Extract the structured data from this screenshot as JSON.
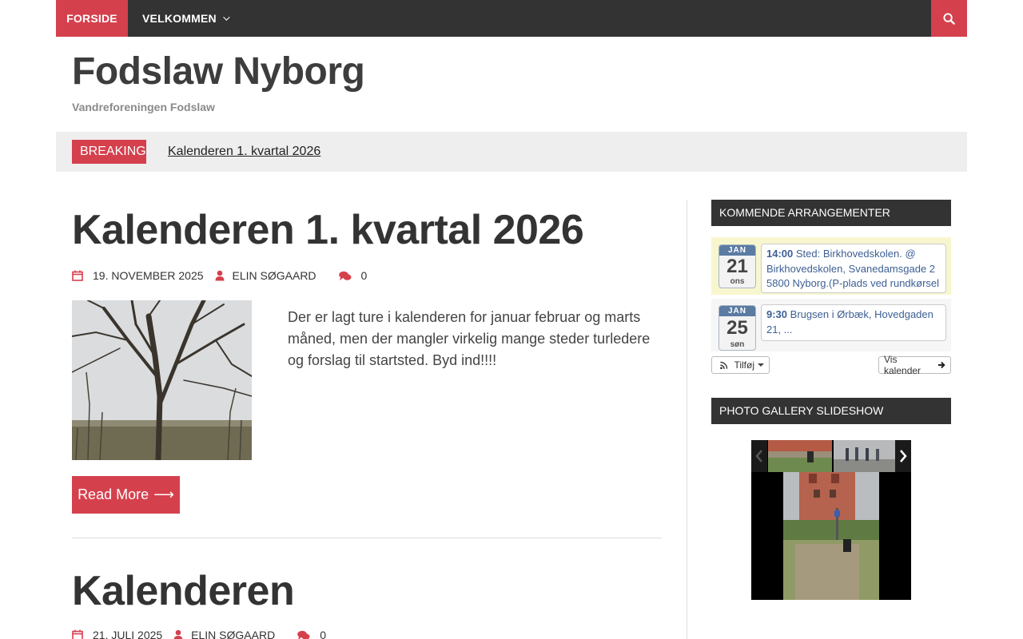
{
  "nav": {
    "items": [
      {
        "label": "Forside"
      },
      {
        "label": "Velkommen"
      }
    ]
  },
  "header": {
    "title": "Fodslaw Nyborg",
    "tagline": "Vandreforeningen Fodslaw"
  },
  "breaking": {
    "label": "BREAKING",
    "link": "Kalenderen 1. kvartal 2026"
  },
  "posts": [
    {
      "title": "Kalenderen 1. kvartal 2026",
      "date": "19. november 2025",
      "author": "Elin Søgaard",
      "comments": "0",
      "excerpt": "Der er lagt ture i kalenderen for januar februar og marts måned, men der mangler virkelig mange steder turledere og forslag til startsted. Byd ind!!!!",
      "read_more": "Read More"
    },
    {
      "title": "Kalenderen",
      "date": "21. juli 2025",
      "author": "Elin Søgaard",
      "comments": "0"
    }
  ],
  "sidebar": {
    "events_title": "Kommende arrangementer",
    "events": [
      {
        "month": "JAN",
        "day": "21",
        "dow": "ons",
        "time": "14:00",
        "text": "Sted: Birkhovedskolen. @ Birkhovedskolen, Svanedamsgade 2 5800 Nyborg.(P-plads ved rundkørsel"
      },
      {
        "month": "JAN",
        "day": "25",
        "dow": "søn",
        "time": "9:30",
        "text": "Brugsen i Ørbæk, Hovedgaden 21, ..."
      }
    ],
    "add_label": "Tilføj",
    "calendar_label": "Vis kalender",
    "gallery_title": "Photo Gallery Slideshow"
  },
  "colors": {
    "accent": "#d5404d",
    "dark": "#333333",
    "event_highlight": "#f8f6cf",
    "event_link": "#3d5f93"
  }
}
